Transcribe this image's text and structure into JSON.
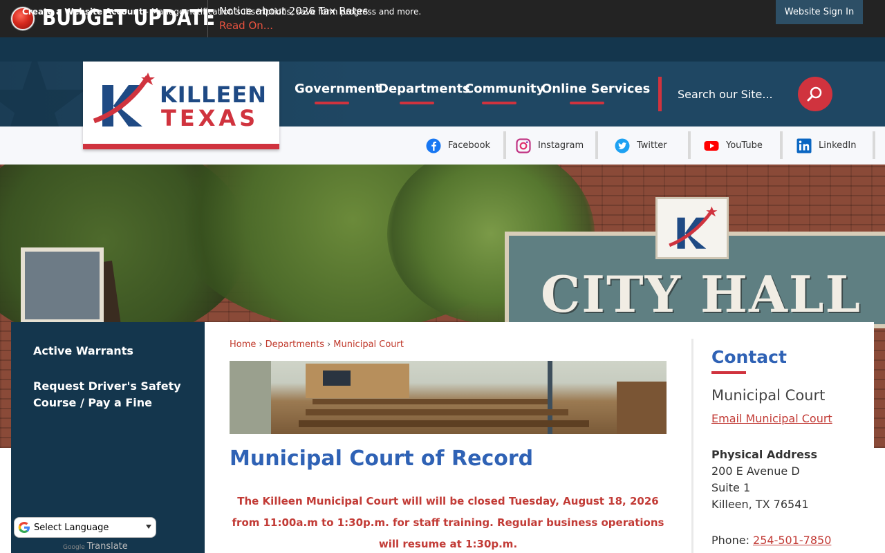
{
  "alert": {
    "title": "BUDGET UPDATE",
    "notice": "Notice about 2026 Tax Rates",
    "link": "Read On..."
  },
  "account": {
    "create_link": "Create a Website Account",
    "description": " - Manage notification subscriptions, save form progress and more.",
    "sign_in": "Website Sign In"
  },
  "logo": {
    "line1": "KILLEEN",
    "line2": "TEXAS"
  },
  "nav": {
    "items": [
      {
        "label": "Government"
      },
      {
        "label": "Departments"
      },
      {
        "label": "Community"
      },
      {
        "label": "Online Services"
      }
    ]
  },
  "search": {
    "placeholder": "Search our Site..."
  },
  "social": {
    "items": [
      {
        "label": "Facebook",
        "icon": "facebook-icon"
      },
      {
        "label": "Instagram",
        "icon": "instagram-icon"
      },
      {
        "label": "Twitter",
        "icon": "twitter-icon"
      },
      {
        "label": "YouTube",
        "icon": "youtube-icon"
      },
      {
        "label": "LinkedIn",
        "icon": "linkedin-icon"
      }
    ]
  },
  "hero": {
    "sign_text": "CITY HALL"
  },
  "sidebar": {
    "items": [
      {
        "label": "Active Warrants"
      },
      {
        "label": "Request Driver's Safety Course / Pay a Fine"
      }
    ]
  },
  "translate": {
    "label": "Select Language",
    "powered_by": "Google",
    "translate_word": "Translate"
  },
  "breadcrumb": {
    "items": [
      "Home",
      "Departments",
      "Municipal Court"
    ]
  },
  "main": {
    "title": "Municipal Court of Record",
    "notice": "The Killeen Municipal Court will will be closed Tuesday, August 18, 2026 from 11:00a.m to 1:30p.m. for staff training. Regular business operations will resume at 1:30p.m."
  },
  "contact": {
    "heading": "Contact",
    "department": "Municipal Court",
    "email_link": "Email Municipal Court",
    "address_label": "Physical Address",
    "address_lines": [
      "200 E Avenue D",
      "Suite 1",
      "Killeen, TX 76541"
    ],
    "phone_label": "Phone: ",
    "phone": "254-501-7850"
  },
  "colors": {
    "navy": "#14364d",
    "brand_red": "#d0333e",
    "title_blue": "#2f62b5"
  }
}
